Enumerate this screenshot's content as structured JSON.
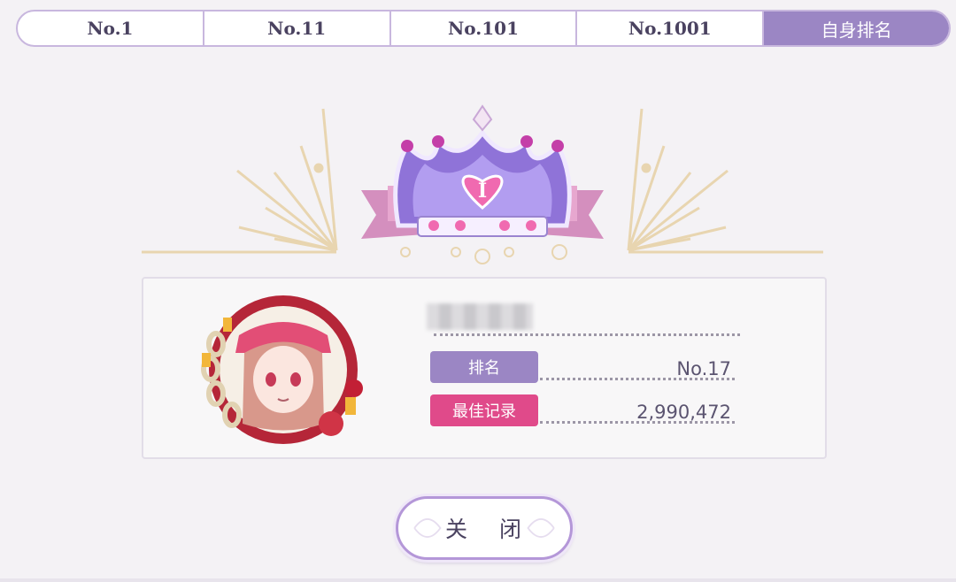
{
  "tabs": [
    {
      "label": "No.1"
    },
    {
      "label": "No.11"
    },
    {
      "label": "No.101"
    },
    {
      "label": "No.1001"
    },
    {
      "label": "自身排名",
      "active": true
    }
  ],
  "emblem": {
    "numeral": "I",
    "icon": "crown-icon"
  },
  "player": {
    "name": "■■■■■■",
    "rank_label": "排名",
    "rank_value": "No.17",
    "best_label": "最佳记录",
    "best_value": "2,990,472"
  },
  "colors": {
    "accent": "#9b86c4",
    "rank_badge": "#9b86c4",
    "best_badge": "#e04a8a"
  },
  "actions": {
    "close_label": "关 闭"
  }
}
